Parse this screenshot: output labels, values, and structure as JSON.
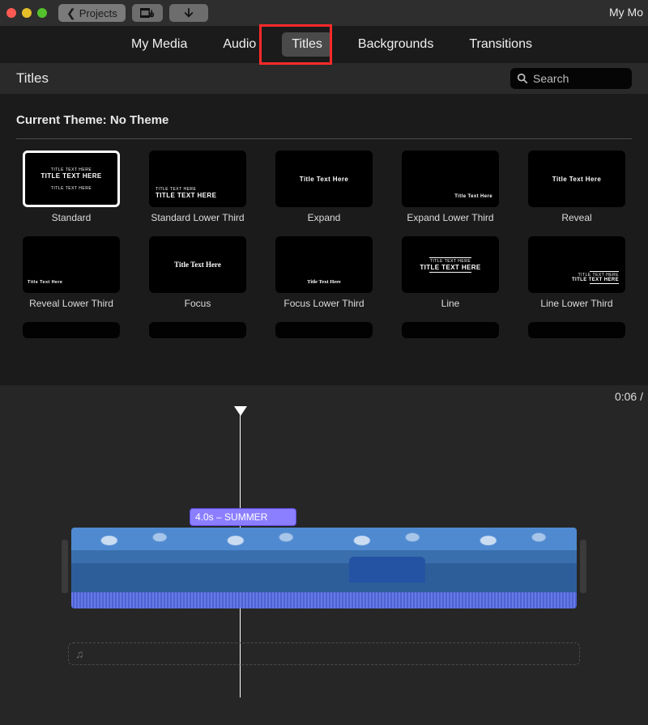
{
  "toolbar": {
    "projects_label": "Projects",
    "project_title": "My Mo"
  },
  "tabs": {
    "my_media": "My Media",
    "audio": "Audio",
    "titles": "Titles",
    "backgrounds": "Backgrounds",
    "transitions": "Transitions",
    "active": "titles"
  },
  "subheader": {
    "label": "Titles",
    "search_placeholder": "Search"
  },
  "theme": {
    "prefix": "Current Theme: ",
    "name": "No Theme"
  },
  "tiles": [
    {
      "label": "Standard",
      "sample_small": "TITLE TEXT HERE",
      "sample_main": "TITLE TEXT HERE",
      "style": "standard",
      "selected": true
    },
    {
      "label": "Standard Lower Third",
      "sample_small": "TITLE TEXT HERE",
      "sample_main": "TITLE TEXT HERE",
      "style": "standardLower"
    },
    {
      "label": "Expand",
      "sample_main": "Title Text Here",
      "style": "expand"
    },
    {
      "label": "Expand Lower Third",
      "sample_main": "Title Text Here",
      "style": "expandLower"
    },
    {
      "label": "Reveal",
      "sample_main": "Title Text Here",
      "style": "reveal"
    },
    {
      "label": "Reveal Lower Third",
      "sample_main": "Title Text Here",
      "style": "revealLower"
    },
    {
      "label": "Focus",
      "sample_main": "Title Text Here",
      "style": "focus"
    },
    {
      "label": "Focus Lower Third",
      "sample_main": "Title Text Here",
      "style": "focusLower"
    },
    {
      "label": "Line",
      "sample_small": "TITLE TEXT HERE",
      "sample_main": "TITLE TEXT HERE",
      "style": "line"
    },
    {
      "label": "Line Lower Third",
      "sample_small": "TITLE TEXT HERE",
      "sample_main": "TITLE TEXT HERE",
      "style": "lineLower"
    }
  ],
  "timeline": {
    "time_display": "0:06 /",
    "title_clip": "4.0s – SUMMER"
  },
  "colors": {
    "highlight": "#ff2a2a",
    "title_clip": "#8b7fff"
  }
}
